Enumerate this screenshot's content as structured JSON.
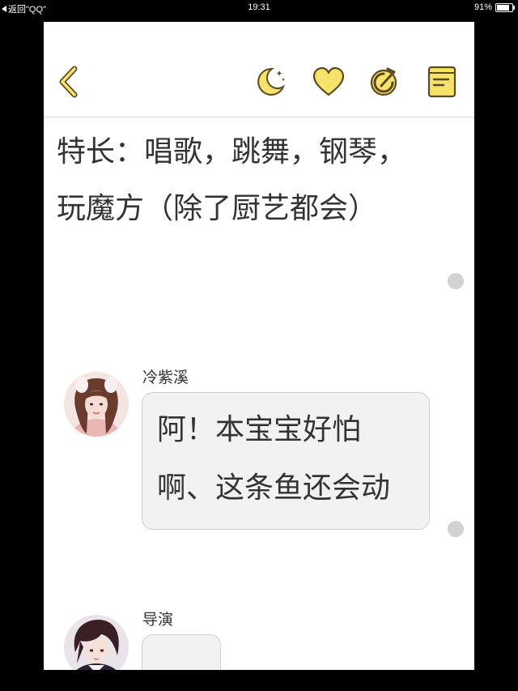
{
  "status_bar": {
    "back_label": "返回\"QQ\"",
    "time": "19:31",
    "battery_text": "91%",
    "battery_level": 0.91
  },
  "toolbar": {
    "icons": [
      "chevron-left-icon",
      "moon-icon",
      "heart-icon",
      "refresh-icon",
      "book-icon"
    ],
    "accent_color": "#f7e26b",
    "stroke_color": "#5a4a1e"
  },
  "story": {
    "narration": "特长：唱歌，跳舞，钢琴，玩魔方（除了厨艺都会）",
    "messages": [
      {
        "speaker": "冷紫溪",
        "text": "阿！本宝宝好怕啊、这条鱼还会动"
      },
      {
        "speaker": "导演",
        "text": "……"
      }
    ]
  }
}
